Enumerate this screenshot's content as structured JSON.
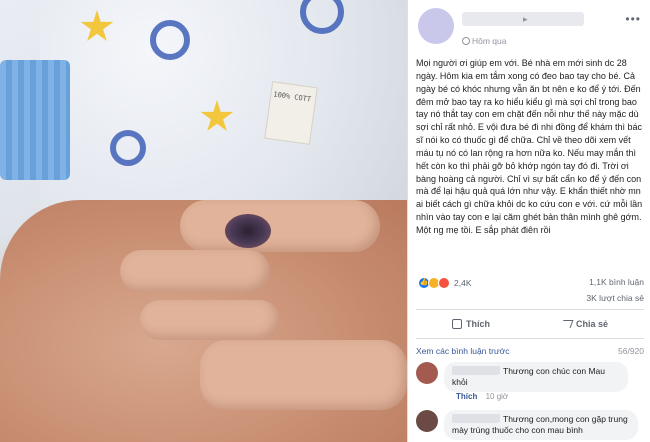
{
  "photo": {
    "tag_text": "100% COTT"
  },
  "post": {
    "time": "Hôm qua",
    "text": "Mọi người ơi giúp em với. Bé nhà em mới sinh dc 28 ngày. Hôm kia em tắm xong có đeo bao tay cho bé. Cả ngày bé có khóc nhưng vẫn ăn bt nên e ko để ý tới. Đến đêm mở bao tay ra ko hiểu kiểu gì mà sợi chỉ trong bao tay nó thắt tay con em chặt đến nỗi như thế này mặc dù sợi chỉ rất nhỏ. E vội đưa bé đi nhi đồng để khám thì bác sĩ nói ko có thuốc gì để chữa. Chỉ về theo dõi xem vết máu tụ nó có lan rộng ra hơn nữa ko. Nếu may mắn thì hết còn ko thì phải gỡ bỏ khớp ngón tay đó đi. Trời ơi bàng hoàng cả người. Chỉ vì sự bất cẩn ko để ý đến con mà để lại hậu quả quá lớn như vậy. E khẩn thiết nhờ mn ai biết cách gì chữa khỏi dc ko cứu con e với. cứ mỗi lần nhìn vào tay con e lại căm ghét bản thân mình ghê gớm. Một ng mẹ tồi. E sắp phát điên rồi"
  },
  "stats": {
    "reaction_count": "2,4K",
    "comments": "1,1K bình luận",
    "shares": "3K lượt chia sẻ"
  },
  "actions": {
    "like": "Thích",
    "share": "Chia sẻ"
  },
  "comments_bar": {
    "view_more": "Xem các bình luận trước",
    "page": "56/920"
  },
  "comments": [
    {
      "text": "Thương con chúc con Mau khỏi",
      "like": "Thích",
      "time": "10 giờ"
    },
    {
      "text": "Thương con,mong con gặp trung mày trúng thuốc cho con mau bình"
    }
  ],
  "colors": {
    "link": "#385898",
    "like_blue": "#1877f2"
  }
}
